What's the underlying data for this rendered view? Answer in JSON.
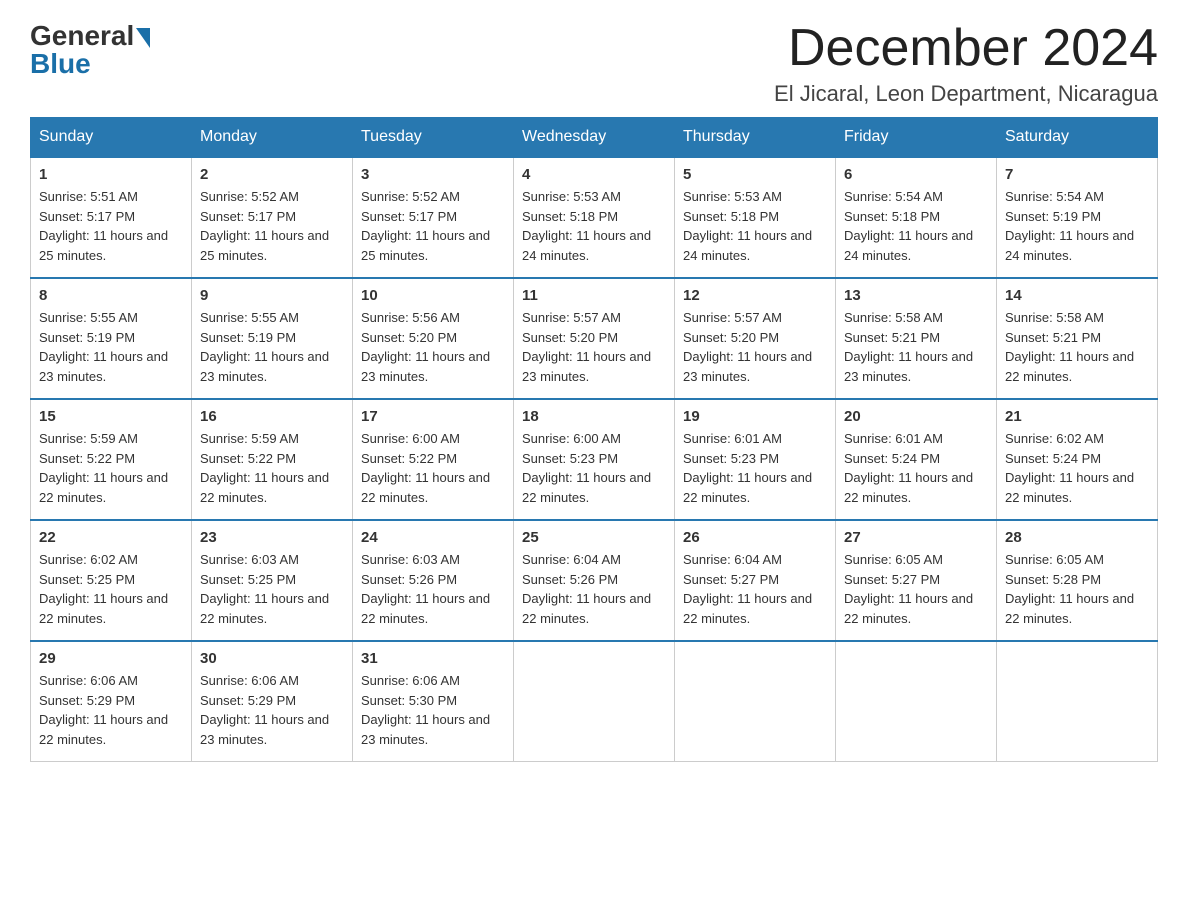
{
  "header": {
    "logo_general": "General",
    "logo_blue": "Blue",
    "month_title": "December 2024",
    "location": "El Jicaral, Leon Department, Nicaragua"
  },
  "days_of_week": [
    "Sunday",
    "Monday",
    "Tuesday",
    "Wednesday",
    "Thursday",
    "Friday",
    "Saturday"
  ],
  "weeks": [
    [
      {
        "day": "1",
        "sunrise": "5:51 AM",
        "sunset": "5:17 PM",
        "daylight": "11 hours and 25 minutes."
      },
      {
        "day": "2",
        "sunrise": "5:52 AM",
        "sunset": "5:17 PM",
        "daylight": "11 hours and 25 minutes."
      },
      {
        "day": "3",
        "sunrise": "5:52 AM",
        "sunset": "5:17 PM",
        "daylight": "11 hours and 25 minutes."
      },
      {
        "day": "4",
        "sunrise": "5:53 AM",
        "sunset": "5:18 PM",
        "daylight": "11 hours and 24 minutes."
      },
      {
        "day": "5",
        "sunrise": "5:53 AM",
        "sunset": "5:18 PM",
        "daylight": "11 hours and 24 minutes."
      },
      {
        "day": "6",
        "sunrise": "5:54 AM",
        "sunset": "5:18 PM",
        "daylight": "11 hours and 24 minutes."
      },
      {
        "day": "7",
        "sunrise": "5:54 AM",
        "sunset": "5:19 PM",
        "daylight": "11 hours and 24 minutes."
      }
    ],
    [
      {
        "day": "8",
        "sunrise": "5:55 AM",
        "sunset": "5:19 PM",
        "daylight": "11 hours and 23 minutes."
      },
      {
        "day": "9",
        "sunrise": "5:55 AM",
        "sunset": "5:19 PM",
        "daylight": "11 hours and 23 minutes."
      },
      {
        "day": "10",
        "sunrise": "5:56 AM",
        "sunset": "5:20 PM",
        "daylight": "11 hours and 23 minutes."
      },
      {
        "day": "11",
        "sunrise": "5:57 AM",
        "sunset": "5:20 PM",
        "daylight": "11 hours and 23 minutes."
      },
      {
        "day": "12",
        "sunrise": "5:57 AM",
        "sunset": "5:20 PM",
        "daylight": "11 hours and 23 minutes."
      },
      {
        "day": "13",
        "sunrise": "5:58 AM",
        "sunset": "5:21 PM",
        "daylight": "11 hours and 23 minutes."
      },
      {
        "day": "14",
        "sunrise": "5:58 AM",
        "sunset": "5:21 PM",
        "daylight": "11 hours and 22 minutes."
      }
    ],
    [
      {
        "day": "15",
        "sunrise": "5:59 AM",
        "sunset": "5:22 PM",
        "daylight": "11 hours and 22 minutes."
      },
      {
        "day": "16",
        "sunrise": "5:59 AM",
        "sunset": "5:22 PM",
        "daylight": "11 hours and 22 minutes."
      },
      {
        "day": "17",
        "sunrise": "6:00 AM",
        "sunset": "5:22 PM",
        "daylight": "11 hours and 22 minutes."
      },
      {
        "day": "18",
        "sunrise": "6:00 AM",
        "sunset": "5:23 PM",
        "daylight": "11 hours and 22 minutes."
      },
      {
        "day": "19",
        "sunrise": "6:01 AM",
        "sunset": "5:23 PM",
        "daylight": "11 hours and 22 minutes."
      },
      {
        "day": "20",
        "sunrise": "6:01 AM",
        "sunset": "5:24 PM",
        "daylight": "11 hours and 22 minutes."
      },
      {
        "day": "21",
        "sunrise": "6:02 AM",
        "sunset": "5:24 PM",
        "daylight": "11 hours and 22 minutes."
      }
    ],
    [
      {
        "day": "22",
        "sunrise": "6:02 AM",
        "sunset": "5:25 PM",
        "daylight": "11 hours and 22 minutes."
      },
      {
        "day": "23",
        "sunrise": "6:03 AM",
        "sunset": "5:25 PM",
        "daylight": "11 hours and 22 minutes."
      },
      {
        "day": "24",
        "sunrise": "6:03 AM",
        "sunset": "5:26 PM",
        "daylight": "11 hours and 22 minutes."
      },
      {
        "day": "25",
        "sunrise": "6:04 AM",
        "sunset": "5:26 PM",
        "daylight": "11 hours and 22 minutes."
      },
      {
        "day": "26",
        "sunrise": "6:04 AM",
        "sunset": "5:27 PM",
        "daylight": "11 hours and 22 minutes."
      },
      {
        "day": "27",
        "sunrise": "6:05 AM",
        "sunset": "5:27 PM",
        "daylight": "11 hours and 22 minutes."
      },
      {
        "day": "28",
        "sunrise": "6:05 AM",
        "sunset": "5:28 PM",
        "daylight": "11 hours and 22 minutes."
      }
    ],
    [
      {
        "day": "29",
        "sunrise": "6:06 AM",
        "sunset": "5:29 PM",
        "daylight": "11 hours and 22 minutes."
      },
      {
        "day": "30",
        "sunrise": "6:06 AM",
        "sunset": "5:29 PM",
        "daylight": "11 hours and 23 minutes."
      },
      {
        "day": "31",
        "sunrise": "6:06 AM",
        "sunset": "5:30 PM",
        "daylight": "11 hours and 23 minutes."
      },
      null,
      null,
      null,
      null
    ]
  ]
}
